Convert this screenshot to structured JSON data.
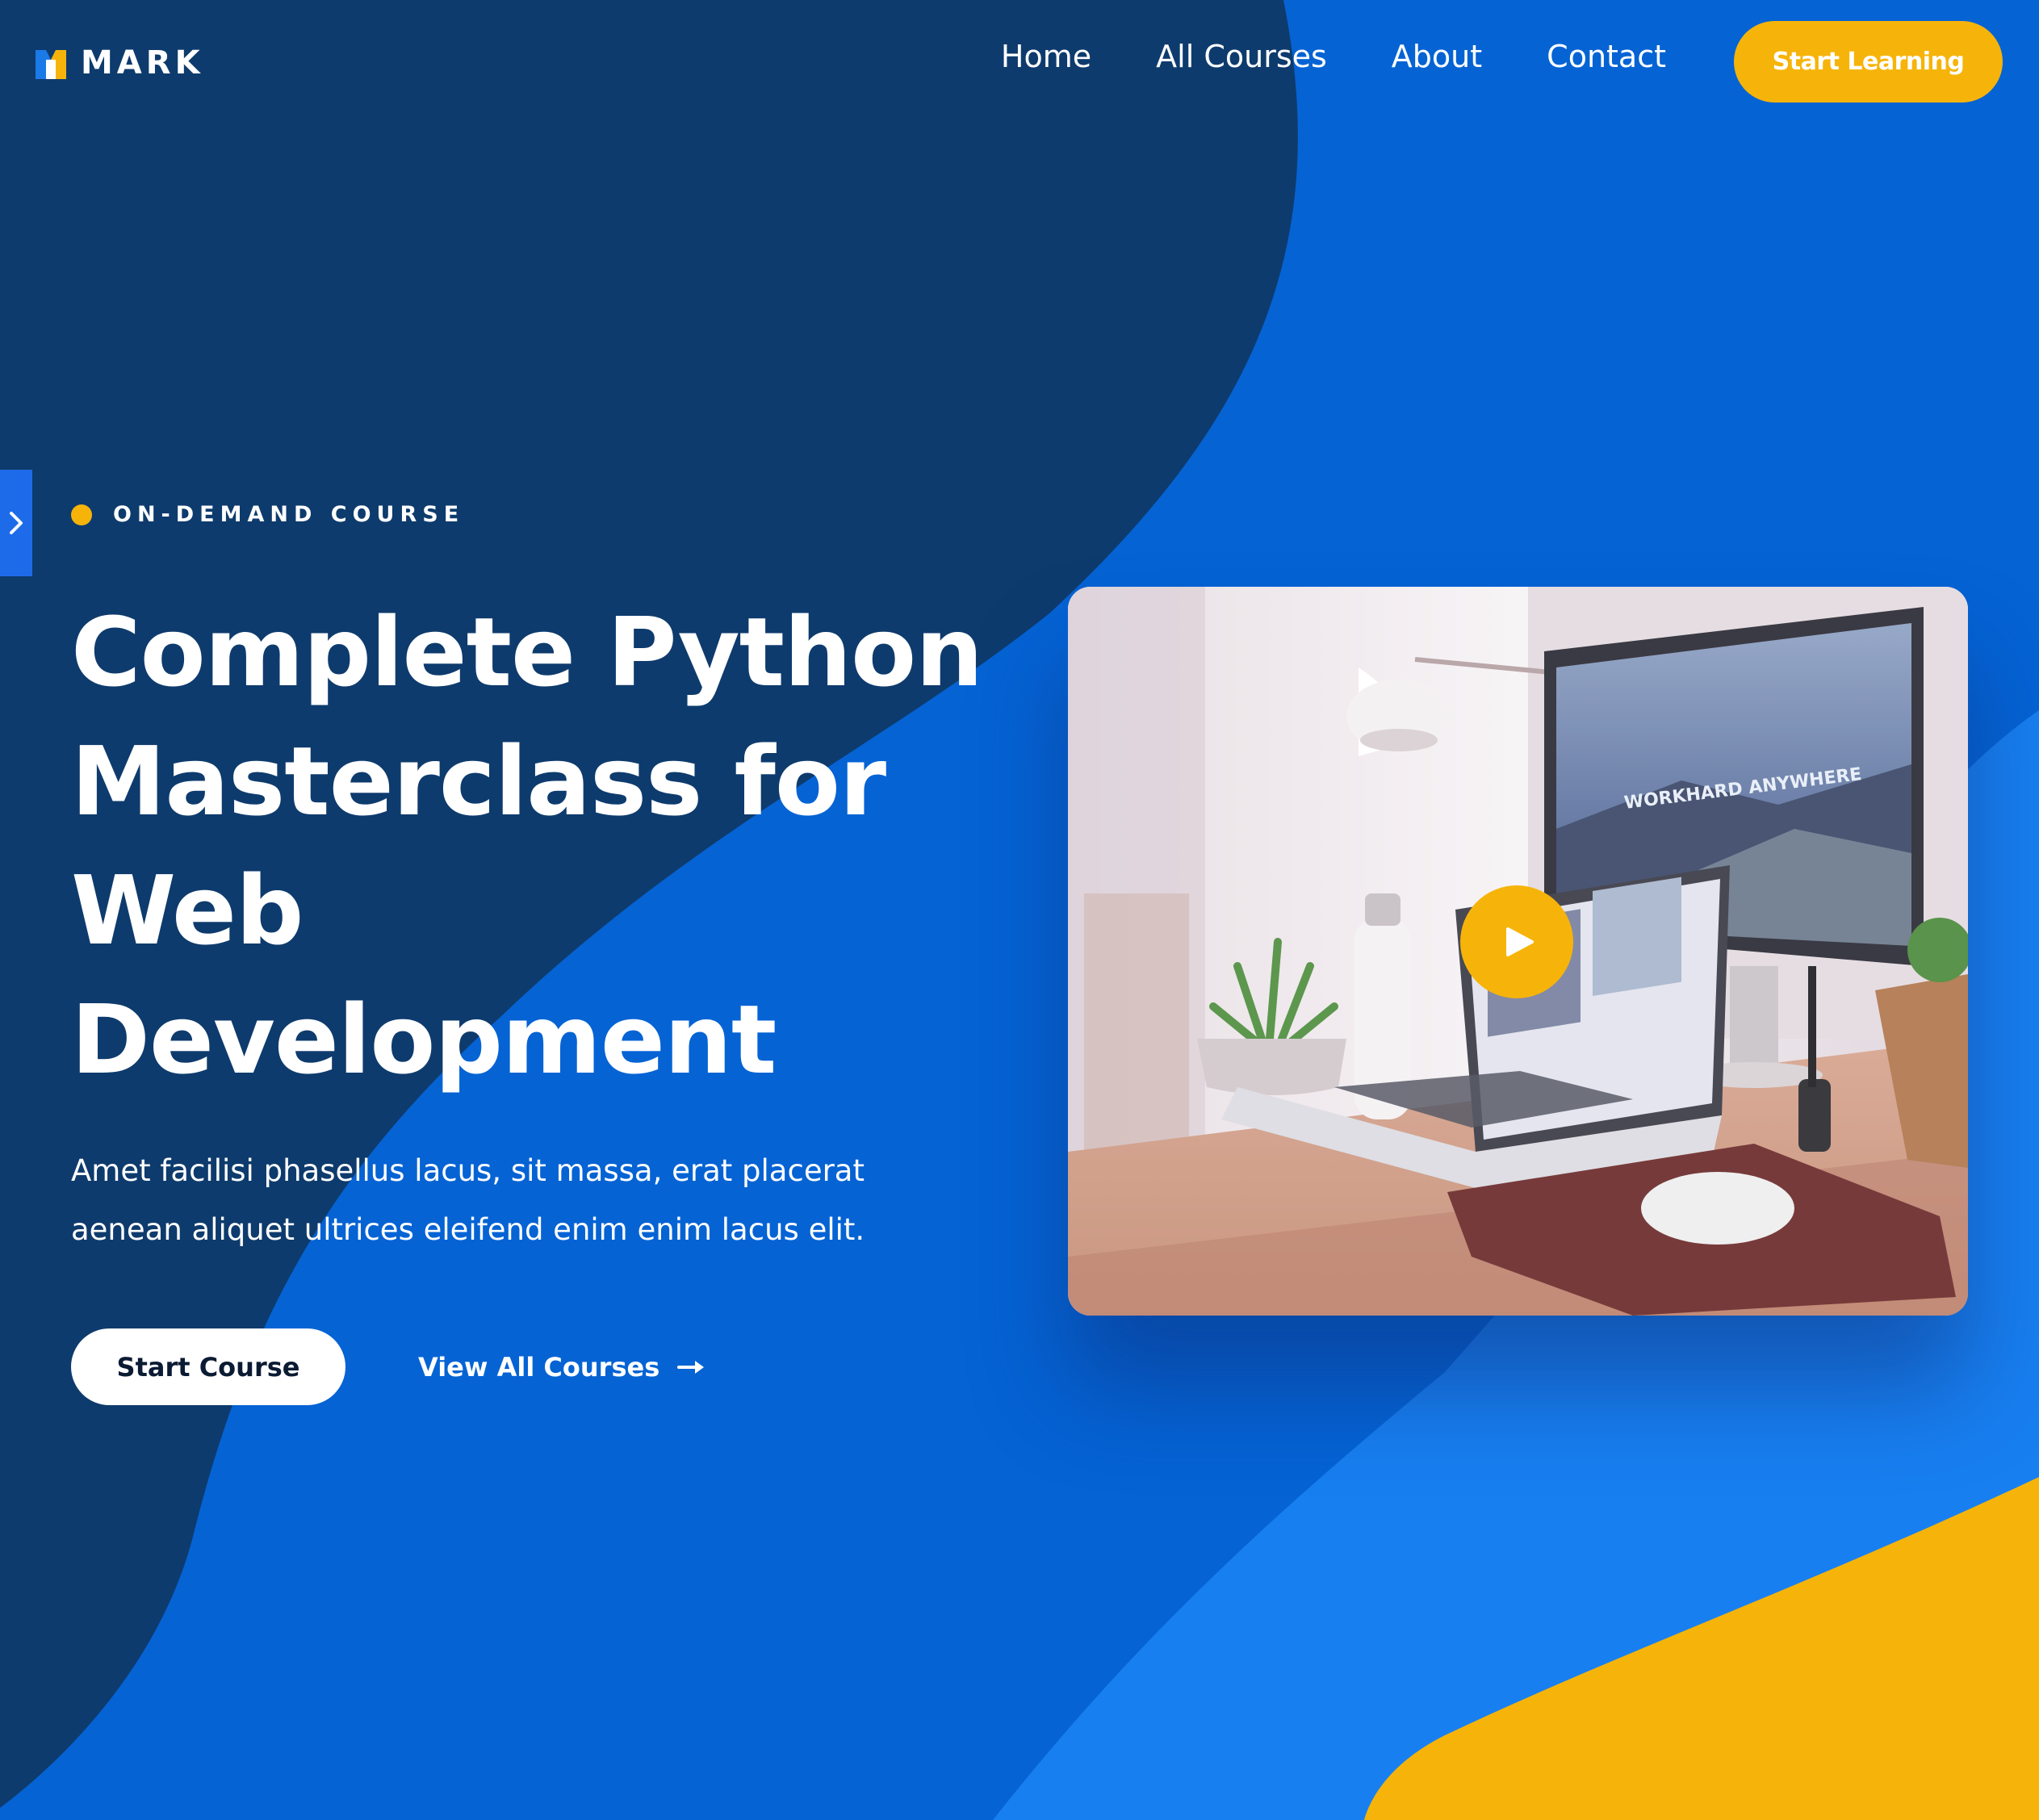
{
  "brand": {
    "name": "MARK",
    "logo_icon": "m-logo-icon"
  },
  "nav": {
    "items": [
      "Home",
      "All Courses",
      "About",
      "Contact"
    ]
  },
  "header_cta": "Start Learning",
  "hero": {
    "eyebrow": "ON-DEMAND COURSE",
    "title_lines": [
      "Complete Python",
      "Masterclass for",
      "Web",
      "Development"
    ],
    "description": "Amet facilisi phasellus lacus, sit massa, erat placerat aenean aliquet ultrices eleifend enim enim lacus elit.",
    "primary_button": "Start Course",
    "secondary_link": "View All Courses"
  },
  "media": {
    "screen_text": "WORKHARD ANYWHERE",
    "play_icon": "play-icon"
  },
  "colors": {
    "navy": "#0e3b6d",
    "royal_blue": "#0563d4",
    "bright_blue": "#187ff0",
    "accent_yellow": "#f6b40a",
    "white": "#ffffff"
  }
}
